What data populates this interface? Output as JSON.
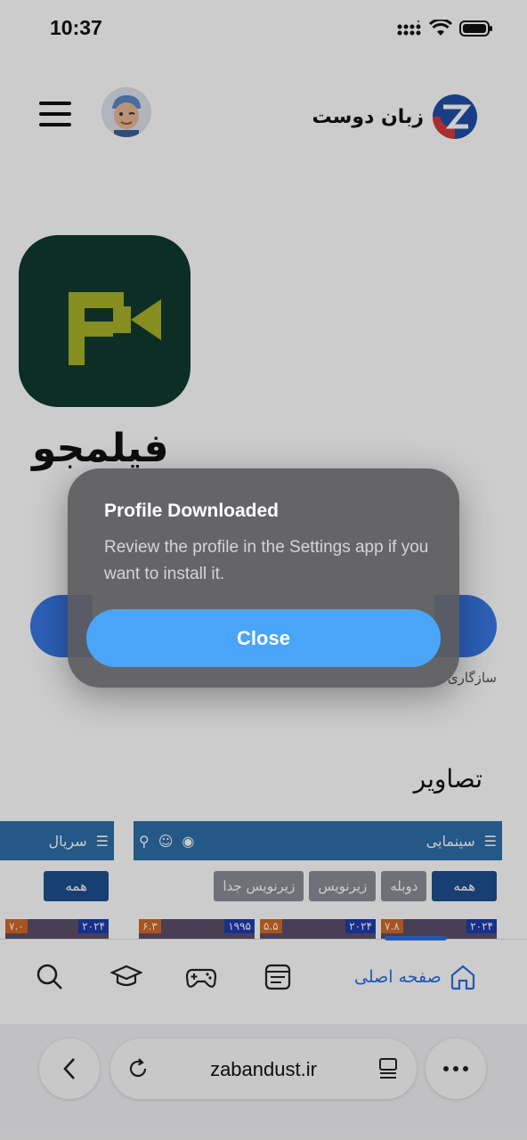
{
  "status_bar": {
    "time": "10:37"
  },
  "header": {
    "brand_name": "زبان دوست"
  },
  "app": {
    "name": "فیلمجو",
    "compat_text": "سازگاری :"
  },
  "pictures": {
    "section_title": "تصاویر",
    "shot1": {
      "bar_title": "سینمایی",
      "tabs": [
        "همه",
        "دوبله",
        "زیرنویس",
        "زیرنویس جدا"
      ],
      "posters": [
        {
          "year": "۲۰۲۴",
          "rating": "۷.۸"
        },
        {
          "year": "۲۰۲۴",
          "rating": "۵.۵"
        },
        {
          "year": "۱۹۹۵",
          "rating": "۶.۳"
        }
      ]
    },
    "shot2": {
      "bar_title": "سریال",
      "tabs": [
        "همه"
      ],
      "posters": [
        {
          "year": "۲۰۲۴",
          "rating": "۷.۰"
        }
      ]
    }
  },
  "tabbar": {
    "home_label": "صفحه اصلی"
  },
  "browser": {
    "url": "zabandust.ir"
  },
  "alert": {
    "title": "Profile Downloaded",
    "message": "Review the profile in the Settings app if you want to install it.",
    "button_label": "Close"
  },
  "colors": {
    "accent": "#4aa5f8",
    "tab_active": "#2a6fe0",
    "app_icon_bg": "#0f3a2e",
    "app_icon_glyph": "#a8b22a"
  }
}
